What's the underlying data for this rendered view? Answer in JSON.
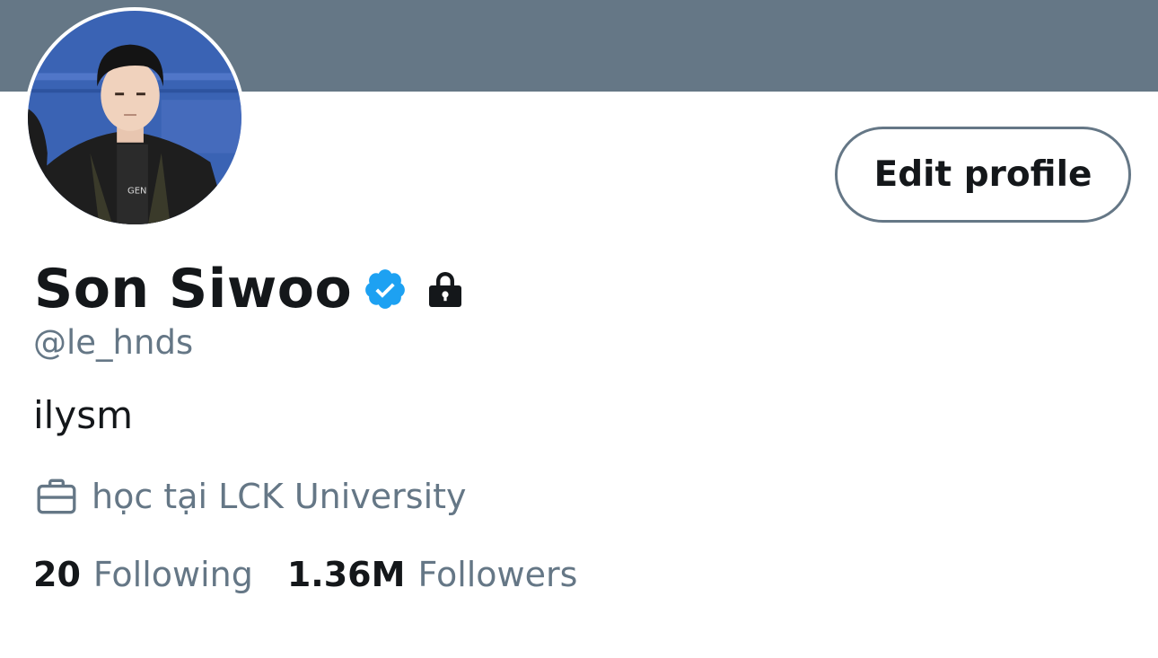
{
  "profile": {
    "display_name": "Son Siwoo",
    "handle": "@le_hnds",
    "bio": "ilysm",
    "work": "học tại LCK University",
    "verified": true,
    "protected": true
  },
  "actions": {
    "edit_profile_label": "Edit profile"
  },
  "stats": {
    "following_count": "20",
    "following_label": "Following",
    "followers_count": "1.36M",
    "followers_label": "Followers"
  },
  "icons": {
    "verified": "verified-badge-icon",
    "lock": "lock-icon",
    "work": "briefcase-icon"
  },
  "colors": {
    "banner": "#657786",
    "verified": "#1DA1F2",
    "text_primary": "#14171A",
    "text_secondary": "#657786"
  }
}
